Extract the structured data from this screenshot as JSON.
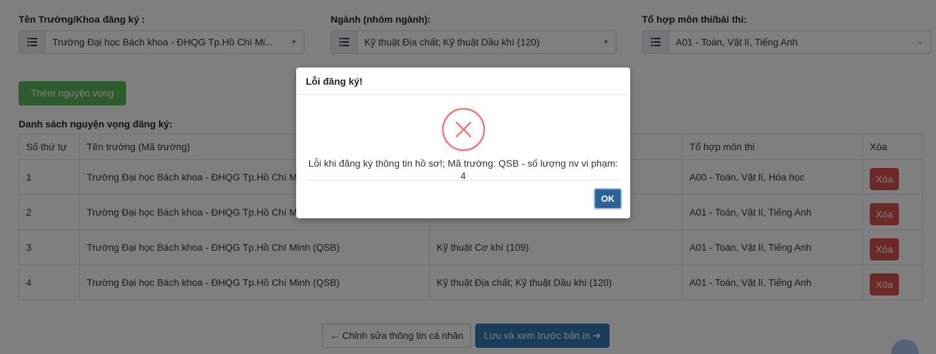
{
  "form": {
    "school_label": "Tên Trường/Khoa đăng ký :",
    "school_value": "Trường Đại học Bách khoa - ĐHQG Tp.Hồ Chí Mi...",
    "major_label": "Ngành (nhóm ngành):",
    "major_value": "Kỹ thuật Địa chất; Kỹ thuật Dầu khí (120)",
    "combo_label": "Tổ hợp môn thi/bài thi:",
    "combo_value": "A01 - Toán, Vật lí, Tiếng Anh"
  },
  "add_button": "Thêm nguyện vọng",
  "list_title": "Danh sách nguyện vọng đăng ký:",
  "table": {
    "headers": [
      "Số thứ tự",
      "Tên trường (Mã trường)",
      "",
      "Tổ hợp môn thi",
      "Xóa"
    ],
    "rows": [
      {
        "no": "1",
        "school": "Trường Đại học Bách khoa - ĐHQG Tp.Hồ Chí Minh (QSB)",
        "major": "",
        "combo": "A00 - Toán, Vật lí, Hóa học",
        "delete": "Xóa"
      },
      {
        "no": "2",
        "school": "Trường Đại học Bách khoa - ĐHQG Tp.Hồ Chí Minh (QSB)",
        "major": "",
        "combo": "A01 - Toán, Vật lí, Tiếng Anh",
        "delete": "Xóa"
      },
      {
        "no": "3",
        "school": "Trường Đại học Bách khoa - ĐHQG Tp.Hồ Chí Minh (QSB)",
        "major": "Kỹ thuật Cơ khí (109)",
        "combo": "A01 - Toán, Vật lí, Tiếng Anh",
        "delete": "Xóa"
      },
      {
        "no": "4",
        "school": "Trường Đại học Bách khoa - ĐHQG Tp.Hồ Chí Minh (QSB)",
        "major": "Kỹ thuật Địa chất; Kỹ thuật Dầu khí (120)",
        "combo": "A01 - Toán, Vật lí, Tiếng Anh",
        "delete": "Xóa"
      }
    ]
  },
  "bottom": {
    "edit_button": "← Chỉnh sửa thông tin cá nhân",
    "save_button": "Lưu và xem trước bản in ➜"
  },
  "modal": {
    "title": "Lỗi đăng ký!",
    "message": "Lỗi khi đăng ký thông tin hồ sơ!; Mã trường: QSB - số lượng nv vi phạm: 4",
    "ok": "OK",
    "icon": "error-x-icon"
  },
  "colors": {
    "success": "#5cb85c",
    "danger": "#d9534f",
    "primary": "#337ab7",
    "error_icon": "#f27474"
  }
}
